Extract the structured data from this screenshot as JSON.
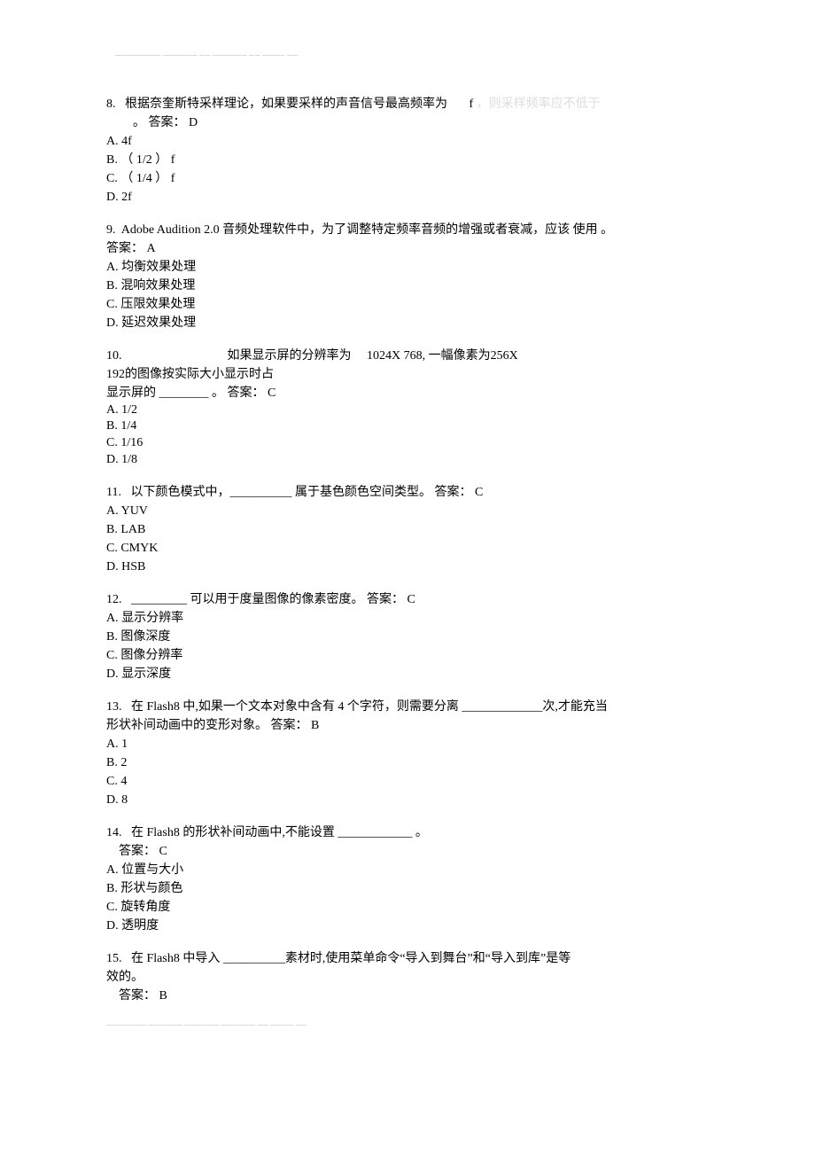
{
  "watermark_top": "————————  ——————  ——\n—————— —— ———— ——",
  "watermark_bottom": "———————  ——————  ——————\n—————— —— ———— ——",
  "q8": {
    "num": "8.",
    "text_a": "根据奈奎斯特采样理论，如果要采样的声音信号最高频率为",
    "text_b": "f",
    "trailing_faded": "，则采样频率应不低于",
    "text_c": "。 答案： D",
    "opts": [
      "A.  4f",
      "B.  （ 1/2 ） f",
      "C.  （ 1/4 ） f",
      "D.  2f"
    ]
  },
  "q9": {
    "num": "9.",
    "text": "Adobe Audition 2.0 音频处理软件中，为了调整特定频率音频的增强或者衰减，应该 使用     。",
    "ans": "答案： A",
    "opts": [
      "A.  均衡效果处理",
      "B.  混响效果处理",
      "C.  压限效果处理",
      "D.  延迟效果处理"
    ]
  },
  "q10": {
    "num": "10.",
    "text_a": "如果显示屏的分辨率为",
    "text_b": "1024X 768,  一幅像素为256X",
    "text_c": "192的图像按实际大小显示时占",
    "text_d": "显示屏的  ________ 。 答案： C",
    "opts": [
      "A.  1/2",
      "B.  1/4",
      "C.  1/16",
      "D.  1/8"
    ]
  },
  "q11": {
    "num": "11.",
    "text": "以下颜色模式中，__________ 属于基色颜色空间类型。 答案： C",
    "opts": [
      "A.  YUV",
      "B.  LAB",
      "C.  CMYK",
      "D.  HSB"
    ]
  },
  "q12": {
    "num": "12.",
    "text": "_________ 可以用于度量图像的像素密度。 答案： C",
    "opts": [
      "A.  显示分辨率",
      "B.  图像深度",
      "C.  图像分辨率",
      "D.  显示深度"
    ]
  },
  "q13": {
    "num": "13.",
    "text_a": "在 Flash8 中,如果一个文本对象中含有 4 个字符，则需要分离  _____________次,才能充当",
    "text_b": "形状补间动画中的变形对象。 答案： B",
    "opts": [
      "A.  1",
      "B.  2",
      "C.  4",
      "D.  8"
    ]
  },
  "q14": {
    "num": "14.",
    "text": "在 Flash8 的形状补间动画中,不能设置  ____________ 。",
    "ans": "答案： C",
    "opts": [
      "A.  位置与大小",
      "B.  形状与颜色",
      "C.  旋转角度",
      "D.  透明度"
    ]
  },
  "q15": {
    "num": "15.",
    "text_a": "在 Flash8 中导入 __________素材时,使用菜单命令“导入到舞台”和“导入到库”是等",
    "text_b": "效的。",
    "ans": "答案： B"
  }
}
